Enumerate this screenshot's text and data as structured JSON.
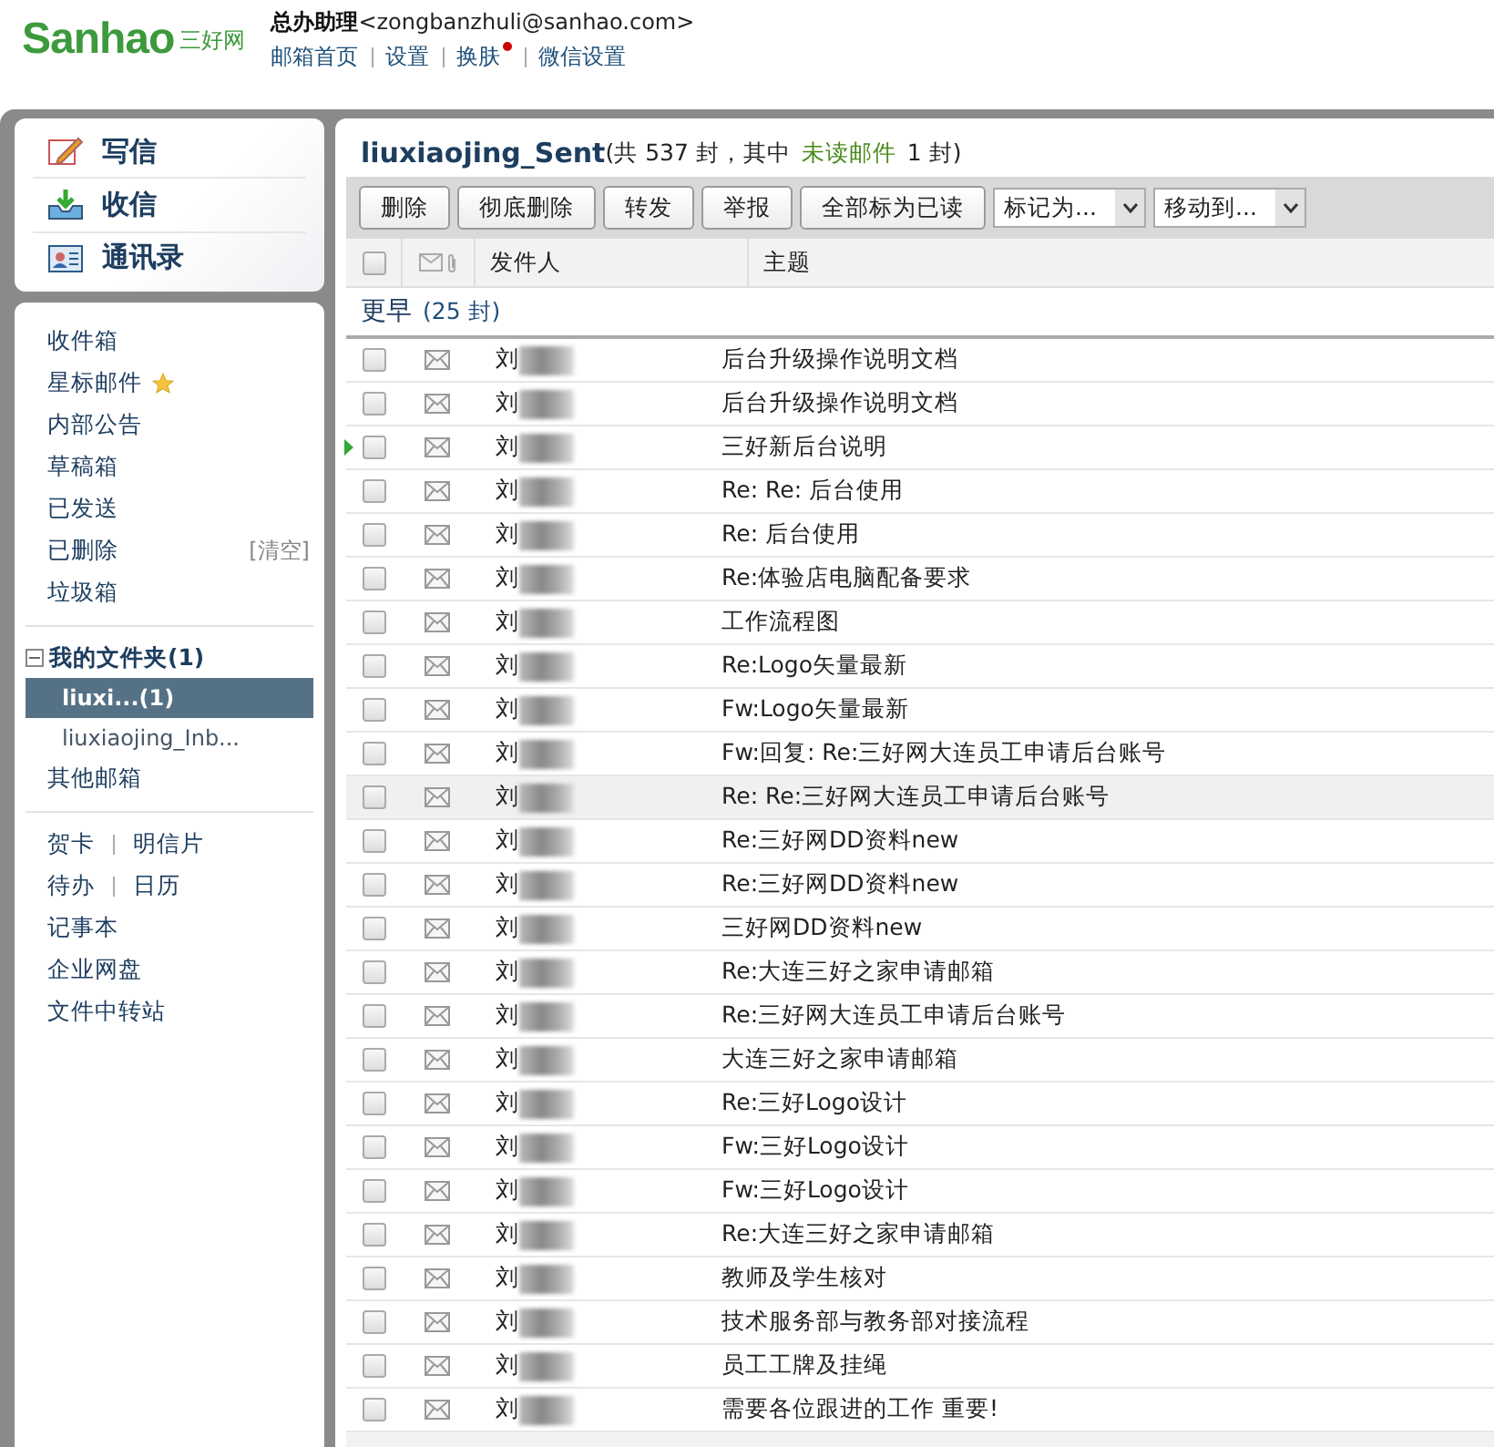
{
  "logo": {
    "brand": "Sanhao",
    "tagline": "三好网"
  },
  "account": {
    "name": "总办助理",
    "email": "<zongbanzhuli@sanhao.com>",
    "links": [
      {
        "label": "邮箱首页",
        "badge": false
      },
      {
        "label": "设置",
        "badge": false
      },
      {
        "label": "换肤",
        "badge": true
      },
      {
        "label": "微信设置",
        "badge": false
      }
    ]
  },
  "quick_actions": [
    {
      "kind": "compose",
      "label": "写信"
    },
    {
      "kind": "inbox",
      "label": "收信"
    },
    {
      "kind": "contacts",
      "label": "通讯录"
    }
  ],
  "folders": [
    {
      "label": "收件箱",
      "starred": false
    },
    {
      "label": "星标邮件",
      "starred": true
    },
    {
      "label": "内部公告",
      "starred": false
    },
    {
      "label": "草稿箱",
      "starred": false
    },
    {
      "label": "已发送",
      "starred": false
    },
    {
      "label": "已删除",
      "starred": false,
      "action": "[清空]"
    },
    {
      "label": "垃圾箱",
      "starred": false
    }
  ],
  "my_folders": {
    "label": "我的文件夹(1)",
    "expanded": true,
    "children": [
      {
        "label": "liuxi...(1)",
        "selected": true
      },
      {
        "label": "liuxiaojing_Inb...",
        "selected": false
      }
    ]
  },
  "other_mail": "其他邮箱",
  "tools": [
    [
      "贺卡",
      "明信片"
    ],
    [
      "待办",
      "日历"
    ],
    [
      "记事本"
    ],
    [
      "企业网盘"
    ],
    [
      "文件中转站"
    ]
  ],
  "mailbox": {
    "name": "liuxiaojing_Sent",
    "summary_start": "(共 537 封，其中",
    "unread_label": "未读邮件",
    "summary_end": "1 封)"
  },
  "toolbar": {
    "buttons": [
      "删除",
      "彻底删除",
      "转发",
      "举报",
      "全部标为已读"
    ],
    "dropdowns": [
      "标记为...",
      "移动到..."
    ]
  },
  "columns": {
    "sender": "发件人",
    "subject": "主题"
  },
  "select_all": {
    "checked": false
  },
  "group": {
    "label": "更早",
    "count": "(25 封)"
  },
  "rows": [
    {
      "sender": "刘",
      "subject": "后台升级操作说明文档",
      "current": false,
      "highlighted": false,
      "checked": false
    },
    {
      "sender": "刘",
      "subject": "后台升级操作说明文档",
      "current": false,
      "highlighted": false,
      "checked": false
    },
    {
      "sender": "刘",
      "subject": "三好新后台说明",
      "current": true,
      "highlighted": false,
      "checked": false
    },
    {
      "sender": "刘",
      "subject": "Re: Re: 后台使用",
      "current": false,
      "highlighted": false,
      "checked": false
    },
    {
      "sender": "刘",
      "subject": "Re: 后台使用",
      "current": false,
      "highlighted": false,
      "checked": false
    },
    {
      "sender": "刘",
      "subject": "Re:体验店电脑配备要求",
      "current": false,
      "highlighted": false,
      "checked": false
    },
    {
      "sender": "刘",
      "subject": "工作流程图",
      "current": false,
      "highlighted": false,
      "checked": false
    },
    {
      "sender": "刘",
      "subject": "Re:Logo矢量最新",
      "current": false,
      "highlighted": false,
      "checked": false
    },
    {
      "sender": "刘",
      "subject": "Fw:Logo矢量最新",
      "current": false,
      "highlighted": false,
      "checked": false
    },
    {
      "sender": "刘",
      "subject": "Fw:回复: Re:三好网大连员工申请后台账号",
      "current": false,
      "highlighted": false,
      "checked": false
    },
    {
      "sender": "刘",
      "subject": "Re: Re:三好网大连员工申请后台账号",
      "current": false,
      "highlighted": true,
      "checked": false
    },
    {
      "sender": "刘",
      "subject": "Re:三好网DD资料new",
      "current": false,
      "highlighted": false,
      "checked": false
    },
    {
      "sender": "刘",
      "subject": "Re:三好网DD资料new",
      "current": false,
      "highlighted": false,
      "checked": false
    },
    {
      "sender": "刘",
      "subject": "三好网DD资料new",
      "current": false,
      "highlighted": false,
      "checked": false
    },
    {
      "sender": "刘",
      "subject": "Re:大连三好之家申请邮箱",
      "current": false,
      "highlighted": false,
      "checked": false
    },
    {
      "sender": "刘",
      "subject": "Re:三好网大连员工申请后台账号",
      "current": false,
      "highlighted": false,
      "checked": false
    },
    {
      "sender": "刘",
      "subject": "大连三好之家申请邮箱",
      "current": false,
      "highlighted": false,
      "checked": false
    },
    {
      "sender": "刘",
      "subject": "Re:三好Logo设计",
      "current": false,
      "highlighted": false,
      "checked": false
    },
    {
      "sender": "刘",
      "subject": "Fw:三好Logo设计",
      "current": false,
      "highlighted": false,
      "checked": false
    },
    {
      "sender": "刘",
      "subject": "Fw:三好Logo设计",
      "current": false,
      "highlighted": false,
      "checked": false
    },
    {
      "sender": "刘",
      "subject": "Re:大连三好之家申请邮箱",
      "current": false,
      "highlighted": false,
      "checked": false
    },
    {
      "sender": "刘",
      "subject": "教师及学生核对",
      "current": false,
      "highlighted": false,
      "checked": false
    },
    {
      "sender": "刘",
      "subject": "技术服务部与教务部对接流程",
      "current": false,
      "highlighted": false,
      "checked": false
    },
    {
      "sender": "刘",
      "subject": "员工工牌及挂绳",
      "current": false,
      "highlighted": false,
      "checked": false
    },
    {
      "sender": "刘",
      "subject": "需要各位跟进的工作 重要!",
      "current": false,
      "highlighted": false,
      "checked": false
    }
  ]
}
